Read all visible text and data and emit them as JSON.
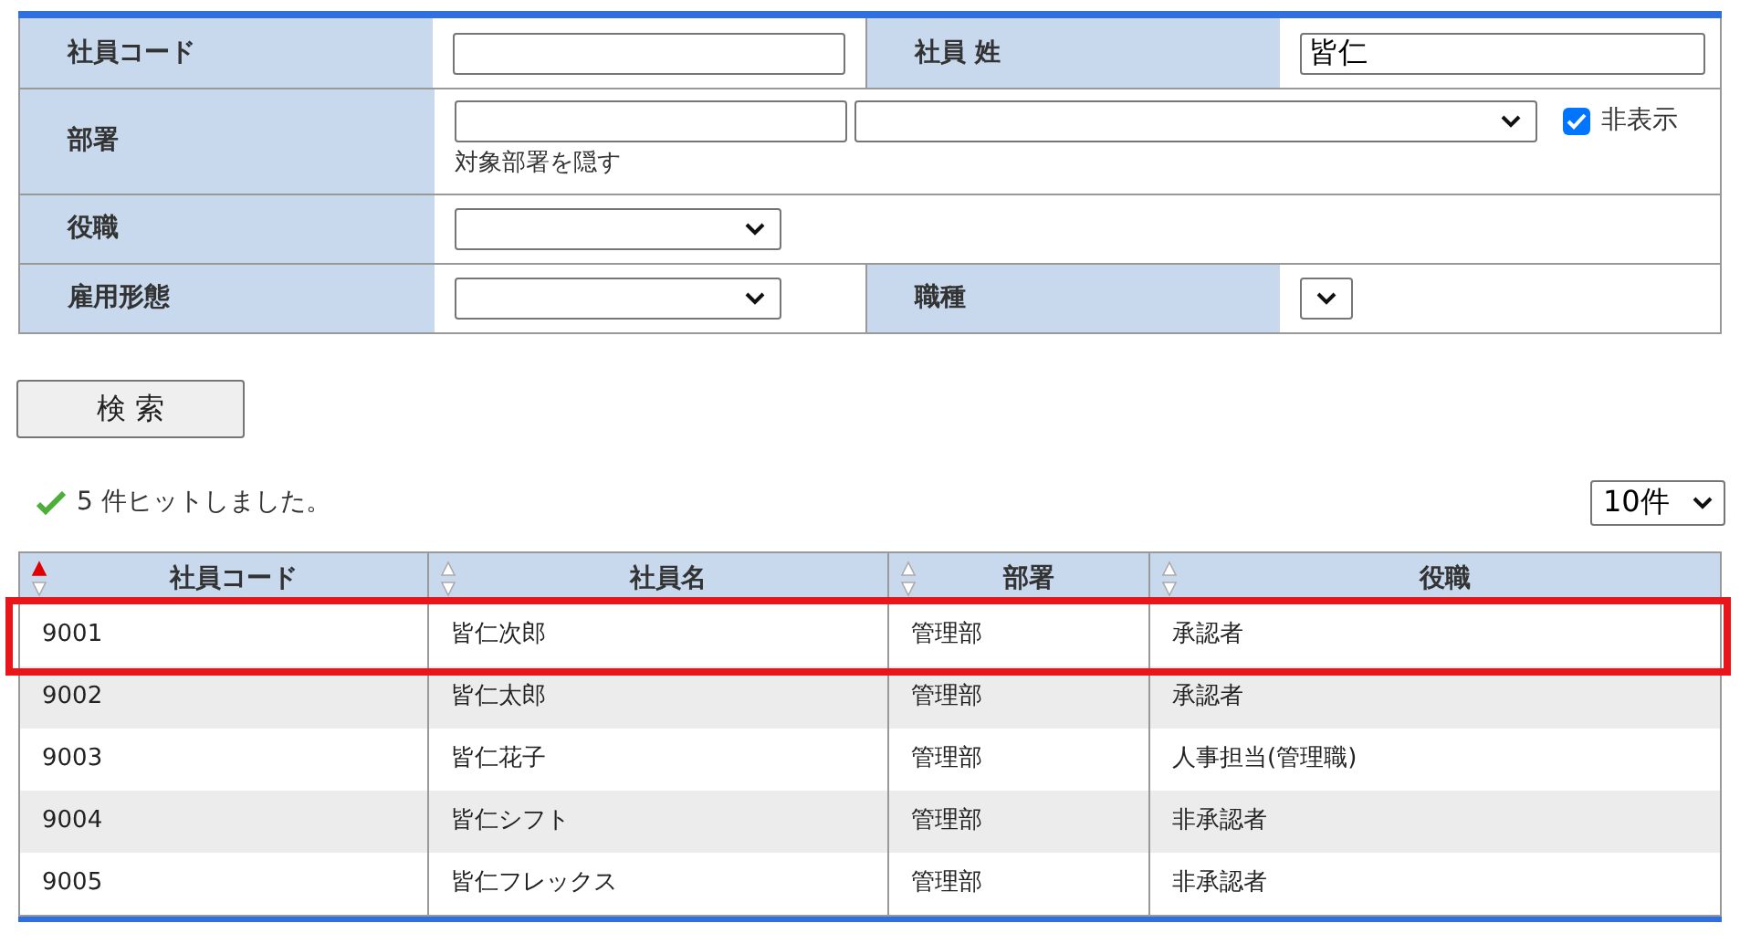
{
  "search_form": {
    "rows": [
      {
        "cells": [
          {
            "label": "社員コード",
            "controls": [
              {
                "kind": "text"
              }
            ]
          },
          {
            "label": "社員 姓",
            "controls": [
              {
                "kind": "text",
                "value": "皆仁"
              }
            ]
          }
        ]
      },
      {
        "cells": [
          {
            "label": "部署",
            "controls": [
              {
                "kind": "text"
              },
              {
                "kind": "select"
              },
              {
                "kind": "checkbox",
                "label": "非表示",
                "checked": true
              }
            ],
            "note": "対象部署を隠す"
          }
        ]
      },
      {
        "cells": [
          {
            "label": "役職",
            "controls": [
              {
                "kind": "select"
              }
            ]
          }
        ]
      },
      {
        "cells": [
          {
            "label": "雇用形態",
            "controls": [
              {
                "kind": "select"
              }
            ]
          },
          {
            "label": "職種",
            "controls": [
              {
                "kind": "select"
              }
            ]
          }
        ]
      }
    ]
  },
  "search_button": "検 索",
  "result": {
    "message": "5 件ヒットしました。",
    "page_size": "10件"
  },
  "table": {
    "columns": [
      {
        "label": "社員コード",
        "sorted": true
      },
      {
        "label": "社員名",
        "sorted": false
      },
      {
        "label": "部署",
        "sorted": false
      },
      {
        "label": "役職",
        "sorted": false
      }
    ],
    "rows": [
      {
        "cells": [
          "9001",
          "皆仁次郎",
          "管理部",
          "承認者"
        ],
        "highlighted": true
      },
      {
        "cells": [
          "9002",
          "皆仁太郎",
          "管理部",
          "承認者"
        ],
        "highlighted": false
      },
      {
        "cells": [
          "9003",
          "皆仁花子",
          "管理部",
          "人事担当(管理職)"
        ],
        "highlighted": false
      },
      {
        "cells": [
          "9004",
          "皆仁シフト",
          "管理部",
          "非承認者"
        ],
        "highlighted": false
      },
      {
        "cells": [
          "9005",
          "皆仁フレックス",
          "管理部",
          "非承認者"
        ],
        "highlighted": false
      }
    ]
  }
}
